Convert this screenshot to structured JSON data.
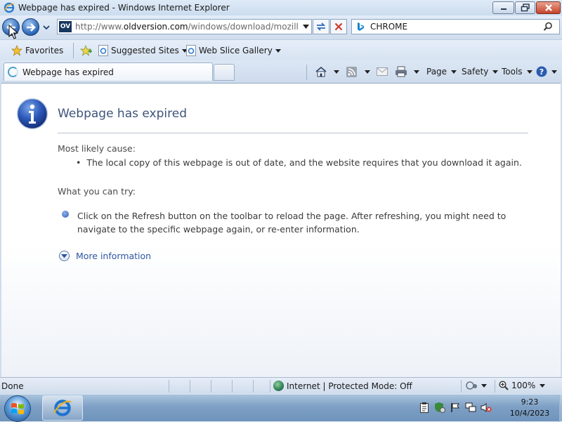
{
  "window": {
    "title": "Webpage has expired - Windows Internet Explorer",
    "controls": {
      "minimize": "minimize",
      "maximize": "maximize",
      "close": "close"
    }
  },
  "address": {
    "site_badge": "OV",
    "url_prefix": "http://www.",
    "url_host": "oldversion.com",
    "url_rest": "/windows/download/mozilla-fir"
  },
  "search": {
    "value": "CHROME",
    "engine_icon": "bing-icon"
  },
  "favorites_bar": {
    "favorites_label": "Favorites",
    "suggested_sites": "Suggested Sites",
    "web_slice_gallery": "Web Slice Gallery"
  },
  "tabs": [
    {
      "label": "Webpage has expired",
      "active": true
    }
  ],
  "command_bar": {
    "page": "Page",
    "safety": "Safety",
    "tools": "Tools"
  },
  "content": {
    "title": "Webpage has expired",
    "cause_heading": "Most likely cause:",
    "cause_item": "The local copy of this webpage is out of date, and the website requires that you download it again.",
    "try_heading": "What you can try:",
    "try_item": "Click on the Refresh button on the toolbar to reload the page. After refreshing, you might need to navigate to the specific webpage again, or re-enter information.",
    "more_info": "More information"
  },
  "status_bar": {
    "status": "Done",
    "zone": "Internet | Protected Mode: Off",
    "zoom": "100%"
  },
  "taskbar": {
    "time": "9:23",
    "date": "10/4/2023"
  },
  "colors": {
    "title_link": "#3e5479",
    "more_info_link": "#2f55a3",
    "chrome_bg": "#cfdcec"
  }
}
